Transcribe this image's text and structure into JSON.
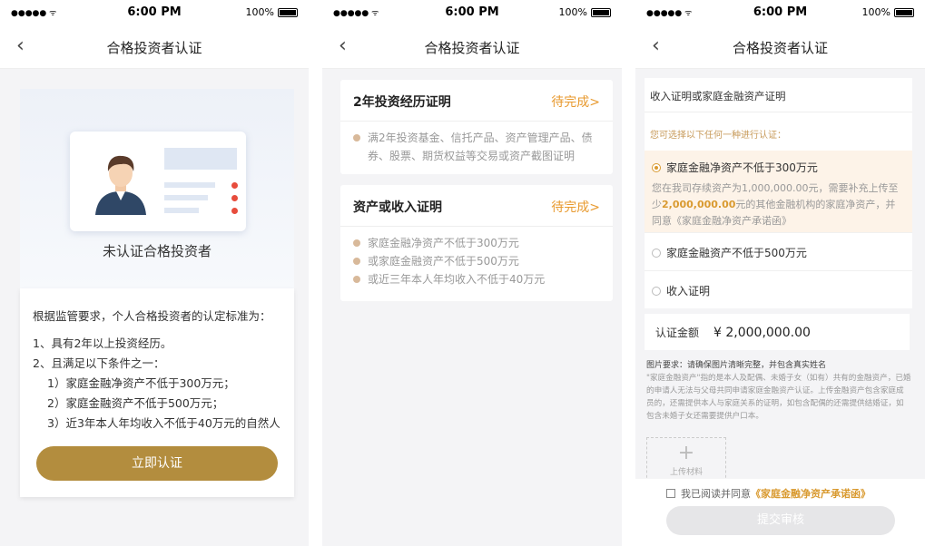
{
  "status": {
    "signal": "●●●●● ᯤ",
    "time": "6:00 PM",
    "battery": "100%"
  },
  "nav": {
    "title": "合格投资者认证",
    "back": "‹"
  },
  "screen1": {
    "hero_label": "未认证合格投资者",
    "intro": "根据监管要求，个人合格投资者的认定标准为：",
    "rules": [
      "1、具有2年以上投资经历。",
      "2、且满足以下条件之一：",
      "1）家庭金融净资产不低于300万元；",
      "2）家庭金融资产不低于500万元；",
      "3）近3年本人年均收入不低于40万元的自然人"
    ],
    "button": "立即认证"
  },
  "screen2": {
    "cards": [
      {
        "title": "2年投资经历证明",
        "status": "待完成>",
        "items": [
          "满2年投资基金、信托产品、资产管理产品、债券、股票、期货权益等交易或资产截图证明"
        ]
      },
      {
        "title": "资产或收入证明",
        "status": "待完成>",
        "items": [
          "家庭金融净资产不低于300万元",
          "或家庭金融资产不低于500万元",
          "或近三年本人年均收入不低于40万元"
        ]
      }
    ]
  },
  "screen3": {
    "section_title": "收入证明或家庭金融资产证明",
    "hint": "您可选择以下任何一种进行认证：",
    "options": [
      {
        "label": "家庭金融净资产不低于300万元",
        "selected": true
      },
      {
        "label": "家庭金融资产不低于500万元",
        "selected": false
      },
      {
        "label": "收入证明",
        "selected": false
      }
    ],
    "selected_desc_pre": "您在我司存续资产为1,000,000.00元，需要补充上传至少",
    "selected_desc_amount": "2,000,000.00",
    "selected_desc_post": "元的其他金融机构的家庭净资产，并同意《家庭金融净资产承诺函》",
    "amount_label": "认证金额",
    "amount_value": "¥ 2,000,000.00",
    "req_title": "图片要求：请确保图片清晰完整，并包含真实姓名",
    "req_body": "\"家庭金融资产\"指的是本人及配偶、未婚子女（如有）共有的金融资产，已婚的申请人无法与父母共同申请家庭金融资产认证。上传金融资产包含家庭成员的，还需提供本人与家庭关系的证明，如包含配偶的还需提供结婚证，如包含未婚子女还需要提供户口本。",
    "upload_label": "上传材料",
    "agree_text": "我已阅读并同意",
    "agree_link": "《家庭金融净资产承诺函》",
    "submit": "提交审核"
  }
}
